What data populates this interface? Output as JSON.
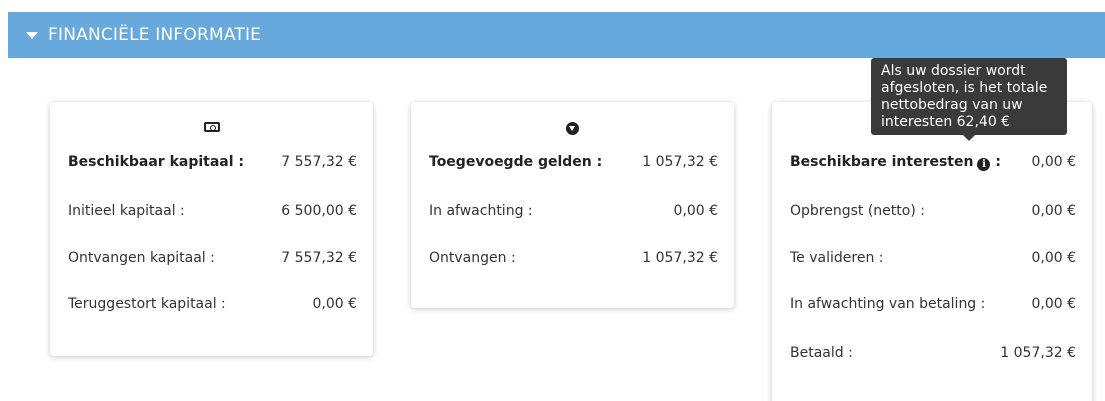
{
  "section": {
    "title": "FINANCIËLE INFORMATIE"
  },
  "capital_card": {
    "icon": "money-bill-icon",
    "rows": [
      {
        "label": "Beschikbaar kapitaal :",
        "value": "7 557,32 €"
      },
      {
        "label": "Initieel kapitaal :",
        "value": "6 500,00 €"
      },
      {
        "label": "Ontvangen kapitaal :",
        "value": "7 557,32 €"
      },
      {
        "label": "Teruggestort kapitaal :",
        "value": "0,00 €"
      }
    ]
  },
  "funds_card": {
    "icon": "arrow-circle-down-icon",
    "rows": [
      {
        "label": "Toegevoegde gelden :",
        "value": "1 057,32 €"
      },
      {
        "label": "In afwachting :",
        "value": "0,00 €"
      },
      {
        "label": "Ontvangen :",
        "value": "1 057,32 €"
      }
    ]
  },
  "interest_card": {
    "icon": "info-circle-icon",
    "rows": [
      {
        "label": "Beschikbare interesten",
        "suffix": ":",
        "value": "0,00 €"
      },
      {
        "label": "Opbrengst (netto) :",
        "value": "0,00 €"
      },
      {
        "label": "Te valideren :",
        "value": "0,00 €"
      },
      {
        "label": "In afwachting van betaling :",
        "value": "0,00 €"
      },
      {
        "label": "Betaald :",
        "value": "1 057,32 €"
      }
    ]
  },
  "tooltip": {
    "text": "Als uw dossier wordt afgesloten, is het totale nettobedrag van uw interesten 62,40 €"
  },
  "colors": {
    "header_bg": "#67a9dc",
    "tooltip_bg": "#3a3a3a"
  }
}
